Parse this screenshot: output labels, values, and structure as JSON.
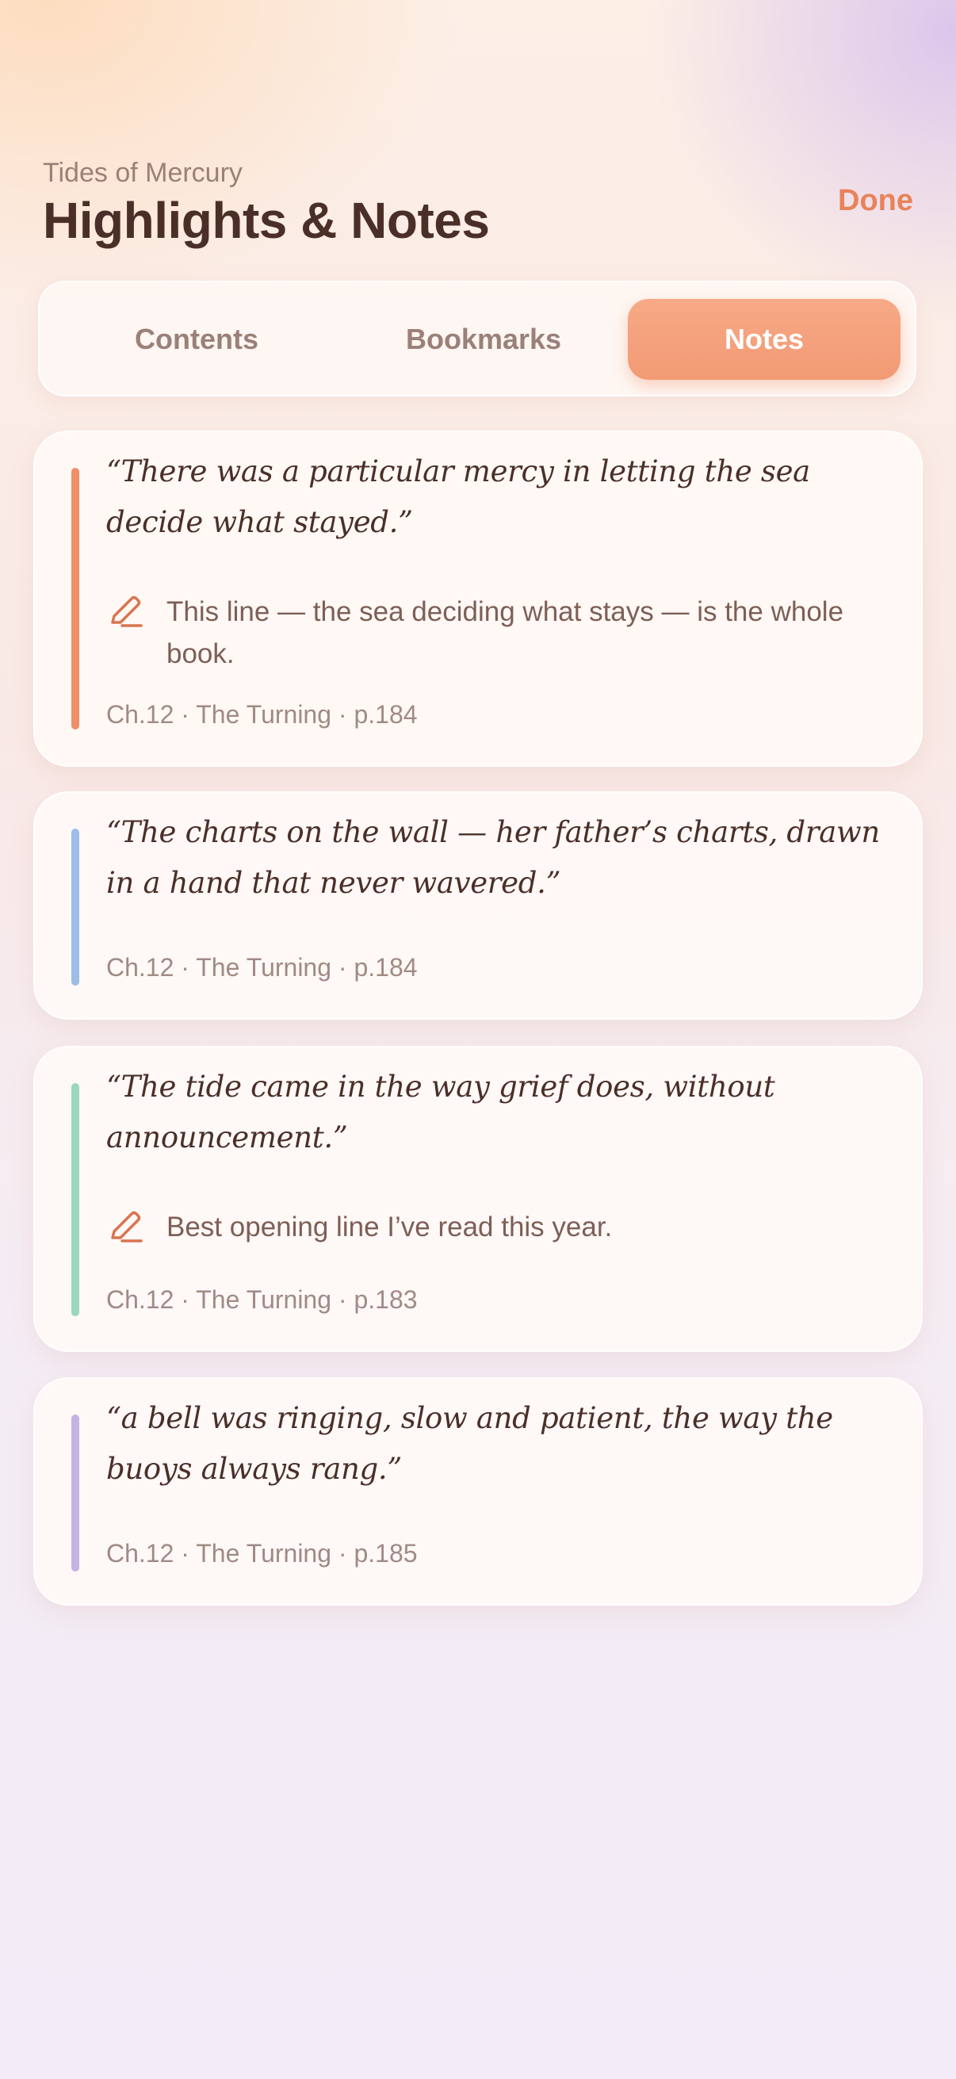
{
  "header": {
    "book_title": "Tides of Mercury",
    "page_title": "Highlights & Notes",
    "done_label": "Done"
  },
  "tabs": [
    {
      "label": "Contents",
      "active": false
    },
    {
      "label": "Bookmarks",
      "active": false
    },
    {
      "label": "Notes",
      "active": true
    }
  ],
  "highlights": [
    {
      "color": "#ef8f68",
      "quote": "“There was a particular mercy in letting the sea decide what stayed.”",
      "note": "This line — the sea deciding what stays — is the whole book.",
      "meta": "Ch.12 · The Turning · p.184"
    },
    {
      "color": "#9dbde6",
      "quote": "“The charts on the wall — her father’s charts, drawn in a hand that never wavered.”",
      "meta": "Ch.12 · The Turning · p.184"
    },
    {
      "color": "#9ad7bd",
      "quote": "“The tide came in the way grief does, without announcement.”",
      "note": "Best opening line I’ve read this year.",
      "meta": "Ch.12 · The Turning · p.183"
    },
    {
      "color": "#c3b3e4",
      "quote": "“a bell was ringing, slow and patient, the way the buoys always rang.”",
      "meta": "Ch.12 · The Turning · p.185"
    }
  ],
  "icons": {
    "note": "pencil-icon"
  },
  "colors": {
    "accent": "#f29a74",
    "title": "#4a2f28"
  }
}
